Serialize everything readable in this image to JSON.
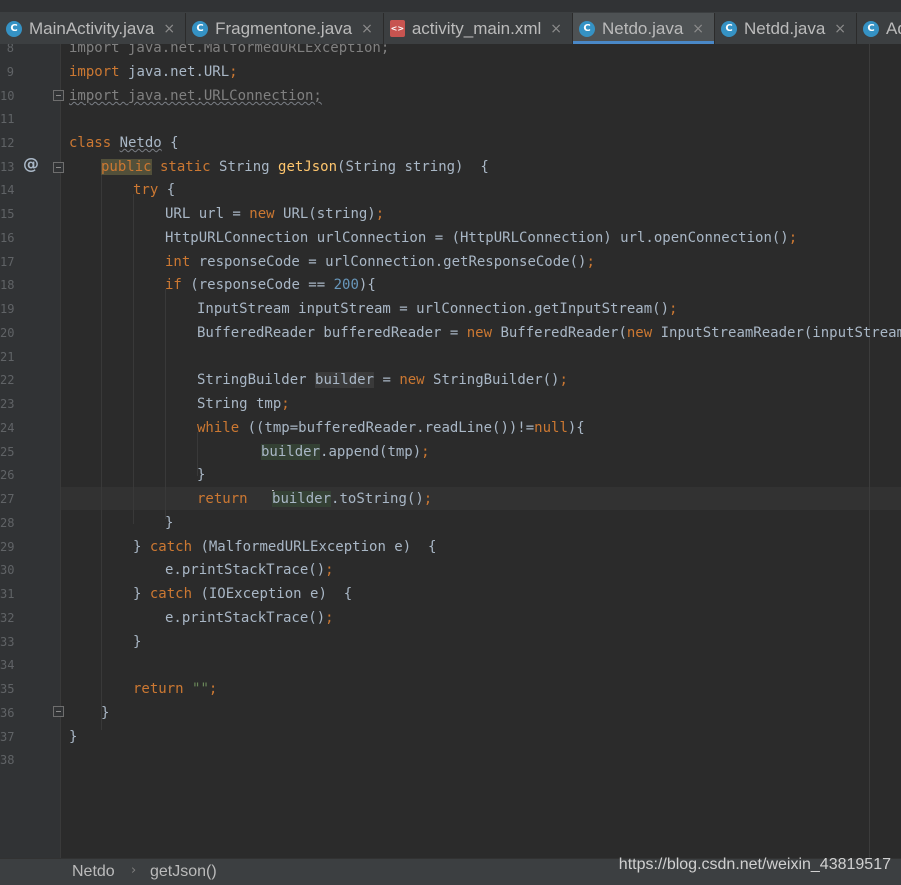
{
  "tabs": [
    {
      "label": "MainActivity.java",
      "icon": "java-class-icon",
      "active": false
    },
    {
      "label": "Fragmentone.java",
      "icon": "java-class-icon",
      "active": false
    },
    {
      "label": "activity_main.xml",
      "icon": "xml-layout-icon",
      "active": false
    },
    {
      "label": "Netdo.java",
      "icon": "java-class-icon",
      "active": true
    },
    {
      "label": "Netdd.java",
      "icon": "java-class-icon",
      "active": false
    },
    {
      "label": "Adap",
      "icon": "java-class-icon",
      "active": false
    }
  ],
  "tab_icon_letter": "C",
  "xml_icon_letter": "<>",
  "close_glyph": "×",
  "line_numbers": [
    "8",
    "9",
    "10",
    "11",
    "12",
    "13",
    "14",
    "15",
    "16",
    "17",
    "18",
    "19",
    "20",
    "21",
    "22",
    "23",
    "24",
    "25",
    "26",
    "27",
    "28",
    "29",
    "30",
    "31",
    "32",
    "33",
    "34",
    "35",
    "36",
    "37",
    "38"
  ],
  "code": {
    "l8": "import java.net.MalformedURLException;",
    "l9a": "import ",
    "l9b": "java.net.URL",
    "l9c": ";",
    "l10": "import java.net.URLConnection;",
    "l12a": "class ",
    "l12b": "Netdo",
    "l12c": " {",
    "l13a": "public",
    "l13b": " static ",
    "l13c": "String ",
    "l13d": "getJson",
    "l13e": "(String string)  {",
    "l14a": "try",
    "l14b": " {",
    "l15a": "URL url = ",
    "l15b": "new ",
    "l15c": "URL(string)",
    "l15d": ";",
    "l16a": "HttpURLConnection urlConnection = (HttpURLConnection) url.openConnection()",
    "l16b": ";",
    "l17a": "int ",
    "l17b": "responseCode = urlConnection.getResponseCode()",
    "l17c": ";",
    "l18a": "if ",
    "l18b": "(responseCode == ",
    "l18c": "200",
    "l18d": "){",
    "l19a": "InputStream inputStream = urlConnection.getInputStream()",
    "l19b": ";",
    "l20a": "BufferedReader bufferedReader = ",
    "l20b": "new ",
    "l20c": "BufferedReader(",
    "l20d": "new ",
    "l20e": "InputStreamReader(inputStream))",
    "l20f": ";",
    "l22a": "StringBuilder ",
    "l22b": "builder",
    "l22c": " = ",
    "l22d": "new ",
    "l22e": "StringBuilder()",
    "l22f": ";",
    "l23a": "String tmp",
    "l23b": ";",
    "l24a": "while ",
    "l24b": "((tmp=bufferedReader.readLine())!=",
    "l24c": "null",
    "l24d": "){",
    "l25a": "builder",
    "l25b": ".append(tmp)",
    "l25c": ";",
    "l26": "}",
    "l27a": "return ",
    "l27b": "builder",
    "l27c": ".toString()",
    "l27d": ";",
    "l28": "}",
    "l29a": "} ",
    "l29b": "catch ",
    "l29c": "(MalformedURLException e)  {",
    "l30a": "e.printStackTrace()",
    "l30b": ";",
    "l31a": "} ",
    "l31b": "catch ",
    "l31c": "(IOException e)  {",
    "l32a": "e.printStackTrace()",
    "l32b": ";",
    "l33": "}",
    "l35a": "return ",
    "l35b": "\"\"",
    "l35c": ";",
    "l36": "}",
    "l37": "}"
  },
  "gutter_marks": {
    "override": "@"
  },
  "breadcrumb": {
    "class": "Netdo",
    "method": "getJson()",
    "separator": "›"
  },
  "watermark": "https://blog.csdn.net/weixin_43819517",
  "colors": {
    "background": "#2b2b2b",
    "keyword": "#cc7832",
    "method": "#ffc66d",
    "number": "#6897bb",
    "string": "#6a8759",
    "text": "#a9b7c6",
    "accent": "#4a88c7"
  }
}
